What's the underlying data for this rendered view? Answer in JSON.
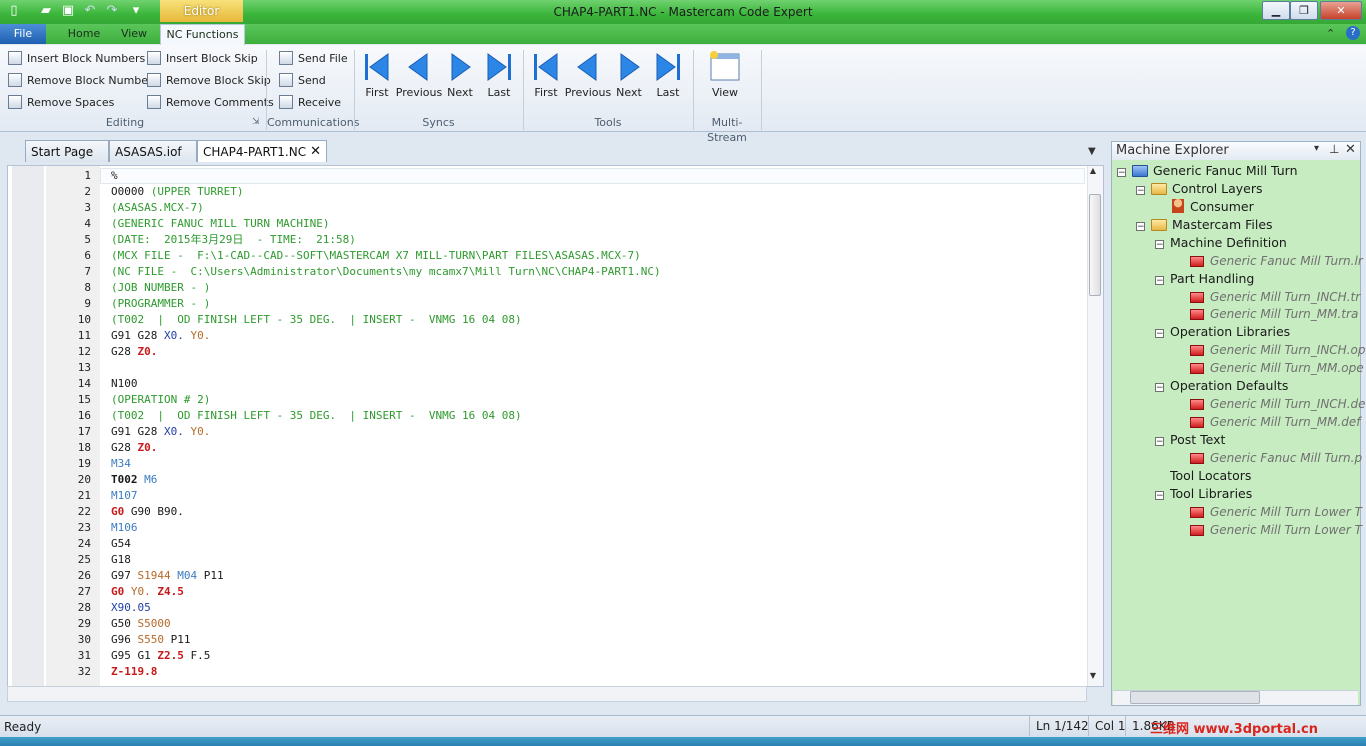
{
  "window": {
    "title": "CHAP4-PART1.NC - Mastercam Code Expert",
    "context_tab": "Editor"
  },
  "ribbon_tabs": [
    "File",
    "Home",
    "View",
    "NC Functions"
  ],
  "ribbon": {
    "editing": {
      "label": "Editing",
      "buttons": [
        "Insert Block Numbers",
        "Remove Block Numbers",
        "Remove Spaces",
        "Insert Block Skip",
        "Remove Block Skip",
        "Remove Comments"
      ]
    },
    "communications": {
      "label": "Communications",
      "buttons": [
        "Send File",
        "Send",
        "Receive"
      ]
    },
    "syncs": {
      "label": "Syncs",
      "buttons": [
        "First",
        "Previous",
        "Next",
        "Last"
      ]
    },
    "tools": {
      "label": "Tools",
      "buttons": [
        "First",
        "Previous",
        "Next",
        "Last"
      ]
    },
    "multistream": {
      "label": "Multi-Stream",
      "buttons": [
        "View"
      ]
    }
  },
  "doc_tabs": [
    "Start Page",
    "ASASAS.iof",
    "CHAP4-PART1.NC"
  ],
  "editor": {
    "lines": [
      "%",
      "O0000 (UPPER TURRET)",
      "(ASASAS.MCX-7)",
      "(GENERIC FANUC MILL TURN MACHINE)",
      "(DATE:  2015年3月29日  - TIME:  21:58)",
      "(MCX FILE -  F:\\1-CAD--CAD--SOFT\\MASTERCAM X7 MILL-TURN\\PART FILES\\ASASAS.MCX-7)",
      "(NC FILE -  C:\\Users\\Administrator\\Documents\\my mcamx7\\Mill Turn\\NC\\CHAP4-PART1.NC)",
      "(JOB NUMBER - )",
      "(PROGRAMMER - )",
      "(T002  |  OD FINISH LEFT - 35 DEG.  | INSERT -  VNMG 16 04 08)",
      "G91 G28 X0. Y0.",
      "G28 Z0.",
      "",
      "N100",
      "(OPERATION # 2)",
      "(T002  |  OD FINISH LEFT - 35 DEG.  | INSERT -  VNMG 16 04 08)",
      "G91 G28 X0. Y0.",
      "G28 Z0.",
      "M34",
      "T002 M6",
      "M107",
      "G0 G90 B90.",
      "M106",
      "G54",
      "G18",
      "G97 S1944 M04 P11",
      "G0 Y0. Z4.5",
      "X90.05",
      "G50 S5000",
      "G96 S550 P11",
      "G95 G1 Z2.5 F.5",
      "Z-119.8"
    ]
  },
  "machine_explorer": {
    "title": "Machine Explorer",
    "root": "Generic Fanuc Mill Turn",
    "control_layers": "Control Layers",
    "consumer": "Consumer",
    "mastercam_files": "Mastercam Files",
    "machine_definition": "Machine Definition",
    "md_file": "Generic Fanuc Mill Turn.lr",
    "part_handling": "Part Handling",
    "ph_files": [
      "Generic Mill Turn_INCH.tr",
      "Generic Mill Turn_MM.tra"
    ],
    "operation_libraries": "Operation Libraries",
    "ol_files": [
      "Generic Mill Turn_INCH.op",
      "Generic Mill Turn_MM.ope"
    ],
    "operation_defaults": "Operation Defaults",
    "od_files": [
      "Generic Mill Turn_INCH.de",
      "Generic Mill Turn_MM.def"
    ],
    "post_text": "Post Text",
    "pt_file": "Generic Fanuc Mill Turn.p",
    "tool_locators": "Tool Locators",
    "tool_libraries": "Tool Libraries",
    "tl_files": [
      "Generic Mill Turn Lower T",
      "Generic Mill Turn Lower T"
    ]
  },
  "status": {
    "text": "Ready",
    "position": "Ln 1/142",
    "column": "Col 1",
    "size": "1.86KB"
  },
  "watermark": "三维网 www.3dportal.cn",
  "colors": {
    "titlebar": "#3bb53b",
    "comment": "#2e9a2e",
    "address_red": "#c81a1a",
    "address_blue": "#2140a6",
    "explorer_bg": "#c7ecc1"
  }
}
